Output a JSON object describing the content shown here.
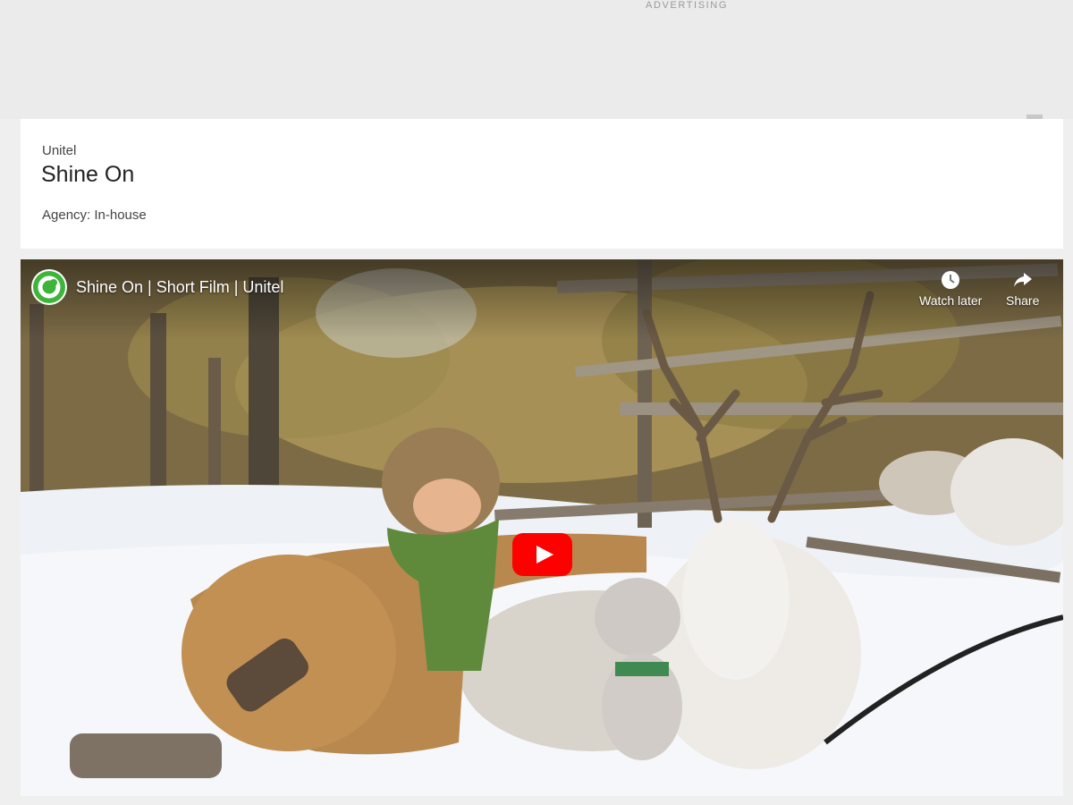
{
  "ad": {
    "label": "ADVERTISING"
  },
  "card": {
    "brand": "Unitel",
    "title": "Shine On",
    "agency": "Agency: In-house"
  },
  "video": {
    "title": "Shine On | Short Film | Unitel",
    "actions": [
      {
        "label": "Watch later",
        "icon": "clock-icon"
      },
      {
        "label": "Share",
        "icon": "share-arrow-icon"
      }
    ],
    "play_color": "#ff0000"
  },
  "colors": {
    "page_bg": "#efefef",
    "card_bg": "#ffffff",
    "channel_logo_green": "#3fb43a"
  }
}
